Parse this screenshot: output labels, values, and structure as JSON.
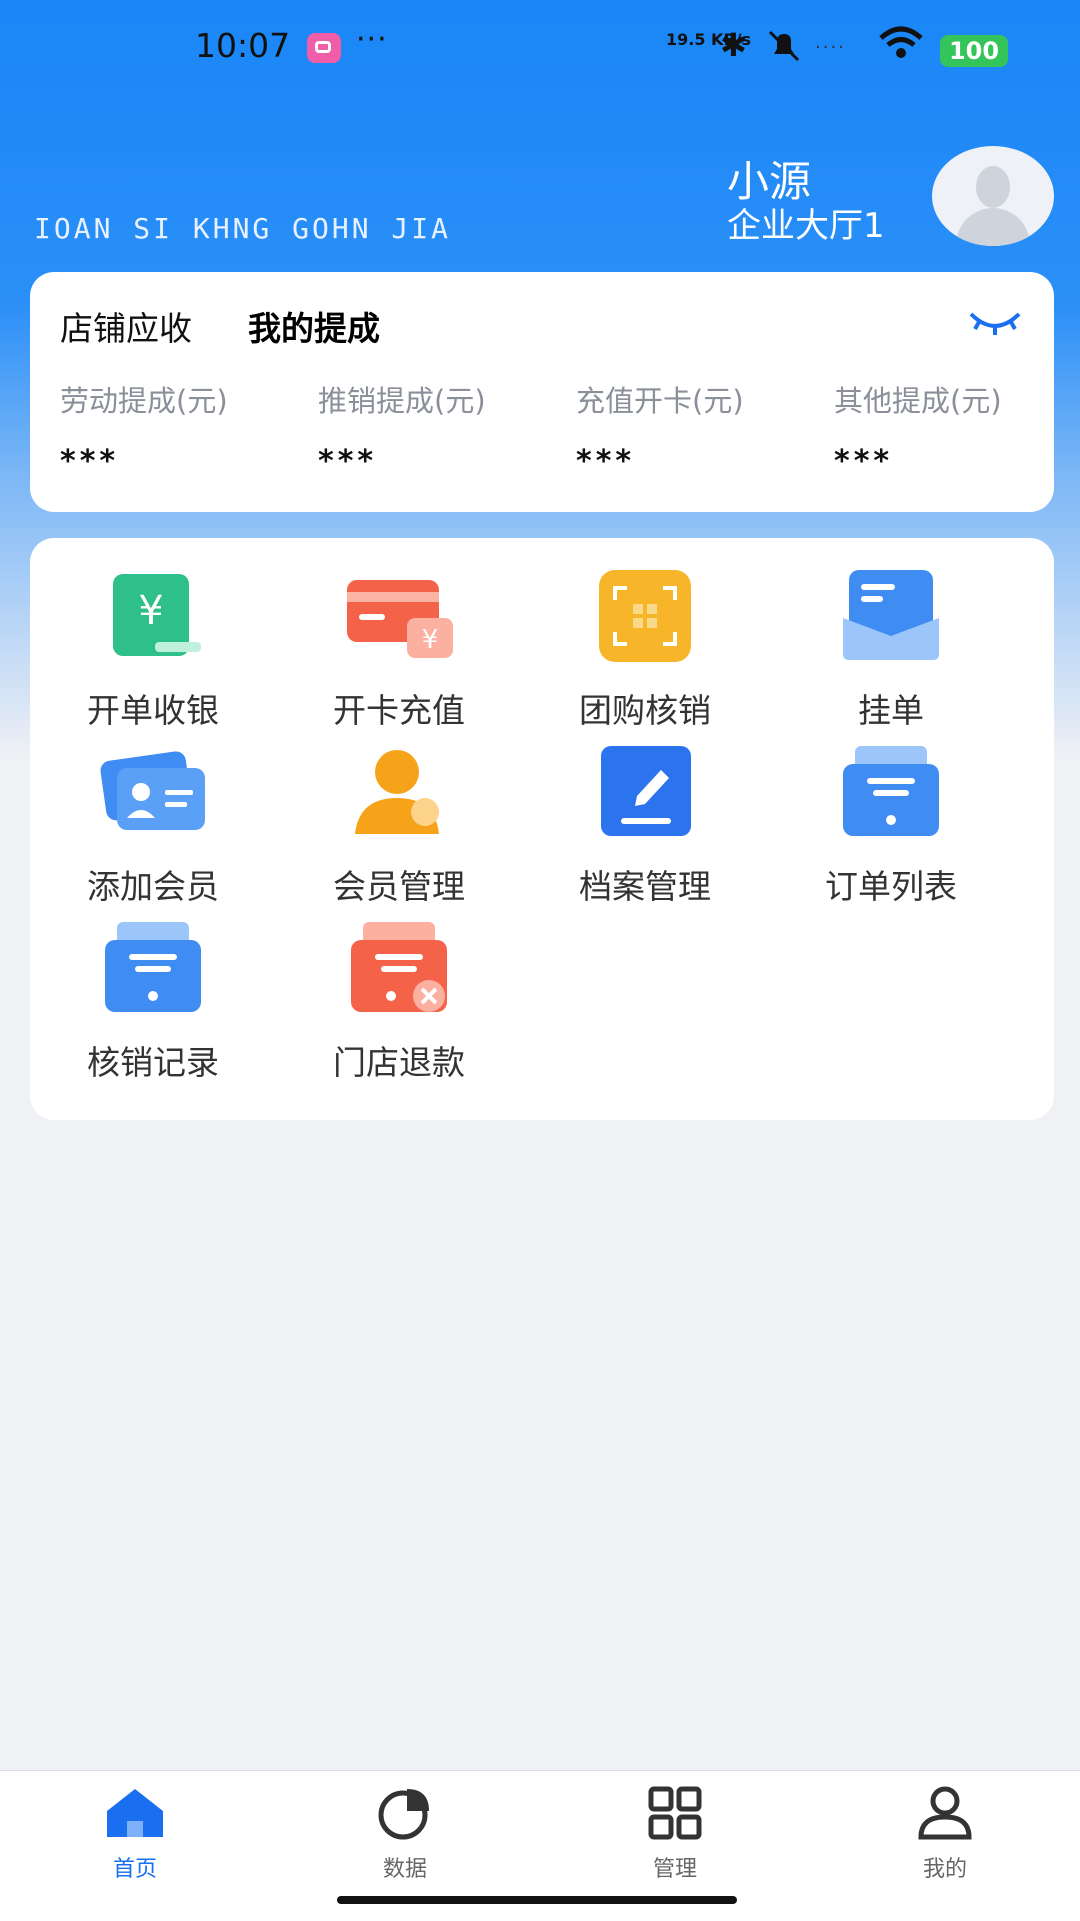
{
  "status_bar": {
    "time": "10:07",
    "speed": "19.5 KB/s",
    "battery": "100"
  },
  "header": {
    "brand": "IOAN SI KHNG GOHN JIA",
    "user_name": "小源",
    "user_store": "企业大厅1"
  },
  "summary_card": {
    "tabs": [
      "店铺应收",
      "我的提成"
    ],
    "stats": [
      {
        "label": "劳动提成(元)",
        "value": "***"
      },
      {
        "label": "推销提成(元)",
        "value": "***"
      },
      {
        "label": "充值开卡(元)",
        "value": "***"
      },
      {
        "label": "其他提成(元)",
        "value": "***"
      }
    ]
  },
  "menu": [
    {
      "label": "开单收银",
      "icon": "cashier-icon",
      "color": "#2fbf8a"
    },
    {
      "label": "开卡充值",
      "icon": "card-recharge-icon",
      "color": "#f5624a"
    },
    {
      "label": "团购核销",
      "icon": "qr-scan-icon",
      "color": "#f7b52a"
    },
    {
      "label": "挂单",
      "icon": "pending-order-icon",
      "color": "#3f8cf2"
    },
    {
      "label": "添加会员",
      "icon": "add-member-icon",
      "color": "#3f8cf2"
    },
    {
      "label": "会员管理",
      "icon": "member-manage-icon",
      "color": "#f6a31a"
    },
    {
      "label": "档案管理",
      "icon": "archive-icon",
      "color": "#2b74ee"
    },
    {
      "label": "订单列表",
      "icon": "order-list-icon",
      "color": "#3f8cf2"
    },
    {
      "label": "核销记录",
      "icon": "verify-record-icon",
      "color": "#3f8cf2"
    },
    {
      "label": "门店退款",
      "icon": "store-refund-icon",
      "color": "#f5624a"
    }
  ],
  "tabbar": [
    {
      "label": "首页",
      "icon": "home-icon",
      "active": true
    },
    {
      "label": "数据",
      "icon": "pie-chart-icon",
      "active": false
    },
    {
      "label": "管理",
      "icon": "grid-icon",
      "active": false
    },
    {
      "label": "我的",
      "icon": "profile-icon",
      "active": false
    }
  ]
}
